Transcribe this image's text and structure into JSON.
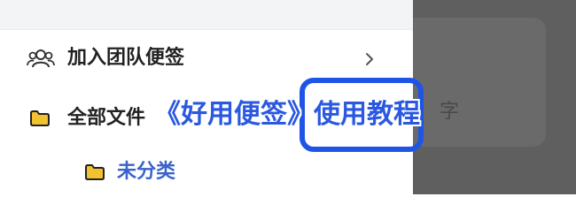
{
  "colors": {
    "accent": "#1f55e6",
    "subfolder_text": "#3a63c9",
    "folder_icon": "#f2c230",
    "overlay": "#5f5f5f"
  },
  "drawer": {
    "items": [
      {
        "label": "加入团队便签",
        "icon": "team-icon",
        "trailing_icon": "chevron-right-icon"
      },
      {
        "label": "全部文件",
        "icon": "folder-icon"
      },
      {
        "label": "未分类",
        "icon": "folder-icon"
      }
    ]
  },
  "overlay": {
    "ghost_text": "字"
  },
  "banner": {
    "title": "《好用便签》使用教程"
  }
}
